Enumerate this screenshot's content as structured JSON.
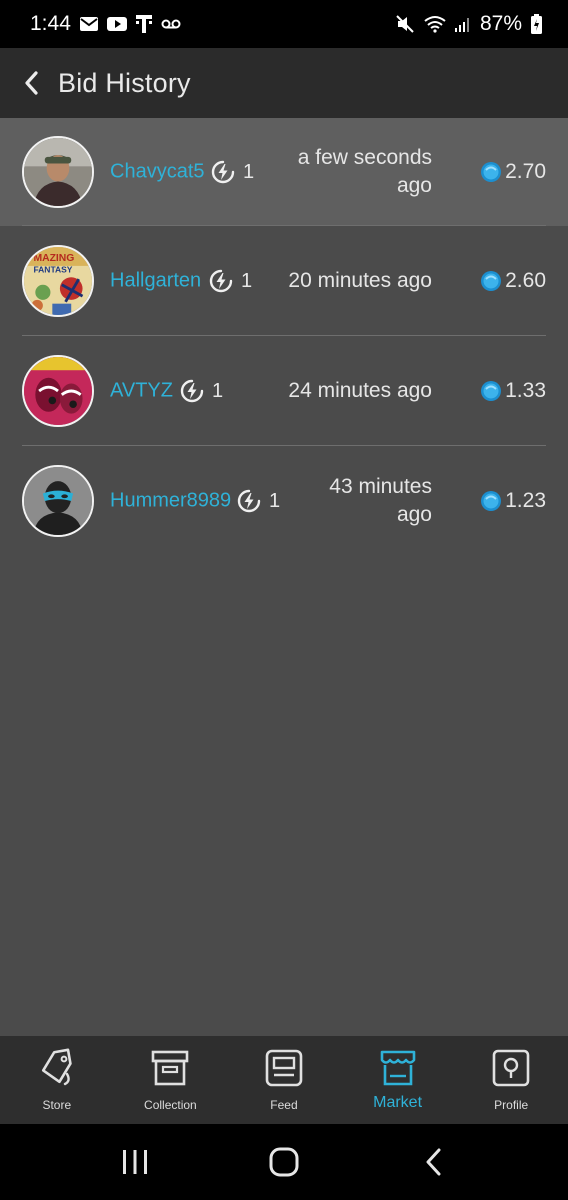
{
  "status_bar": {
    "time": "1:44",
    "battery": "87%"
  },
  "header": {
    "title": "Bid History"
  },
  "bids": [
    {
      "username": "Chavycat5",
      "count": "1",
      "time_line1": "a few seconds",
      "time_line2": "ago",
      "amount": "2.70"
    },
    {
      "username": "Hallgarten",
      "count": "1",
      "time_line1": "20 minutes ago",
      "time_line2": "",
      "amount": "2.60"
    },
    {
      "username": "AVTYZ",
      "count": "1",
      "time_line1": "24 minutes ago",
      "time_line2": "",
      "amount": "1.33"
    },
    {
      "username": "Hummer8989",
      "count": "1",
      "time_line1": "43 minutes",
      "time_line2": "ago",
      "amount": "1.23"
    }
  ],
  "bottom_nav": {
    "items": [
      {
        "label": "Store",
        "icon": "tag-icon"
      },
      {
        "label": "Collection",
        "icon": "archive-box-icon"
      },
      {
        "label": "Feed",
        "icon": "feed-card-icon"
      },
      {
        "label": "Market",
        "icon": "storefront-icon"
      },
      {
        "label": "Profile",
        "icon": "profile-pin-icon"
      }
    ],
    "active": "Market"
  },
  "colors": {
    "accent": "#2fb2d8",
    "background": "#4b4b4b",
    "header": "#2b2b2b",
    "highlight_row": "#5f5f5f"
  }
}
